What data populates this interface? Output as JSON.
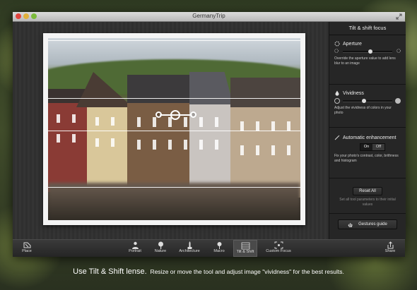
{
  "window": {
    "title": "GermanyTrip"
  },
  "panel": {
    "title": "Tilt & shift focus",
    "aperture": {
      "label": "Aperture",
      "desc": "Override the aperture value to add lens blur to an image",
      "value": 0.55
    },
    "vividness": {
      "label": "Vividness",
      "desc": "Adjust the vividness of colors in your photo",
      "value": 0.43
    },
    "auto": {
      "label": "Automatic enhancement",
      "on": "On",
      "off": "Off",
      "selected": "On",
      "desc": "Fix your photo's contrast, color, brithness and histogram"
    },
    "reset": {
      "label": "Reset All",
      "desc": "Set all tool parameters to their initial values"
    },
    "guide": {
      "label": "Gestures guide"
    }
  },
  "toolbar": {
    "place": "Place",
    "items": [
      "Portrait",
      "Nature",
      "Architecture",
      "Macro",
      "Tilt & Shift",
      "Custom Focus"
    ],
    "active": "Tilt & Shift",
    "share": "Share"
  },
  "caption": {
    "lead": "Use Tilt & Shift lense.",
    "rest": "Resize or move the tool and adjust image \"vividness\" for the best results."
  },
  "colors": {
    "accent": "#ffffff",
    "panel": "#262626"
  }
}
